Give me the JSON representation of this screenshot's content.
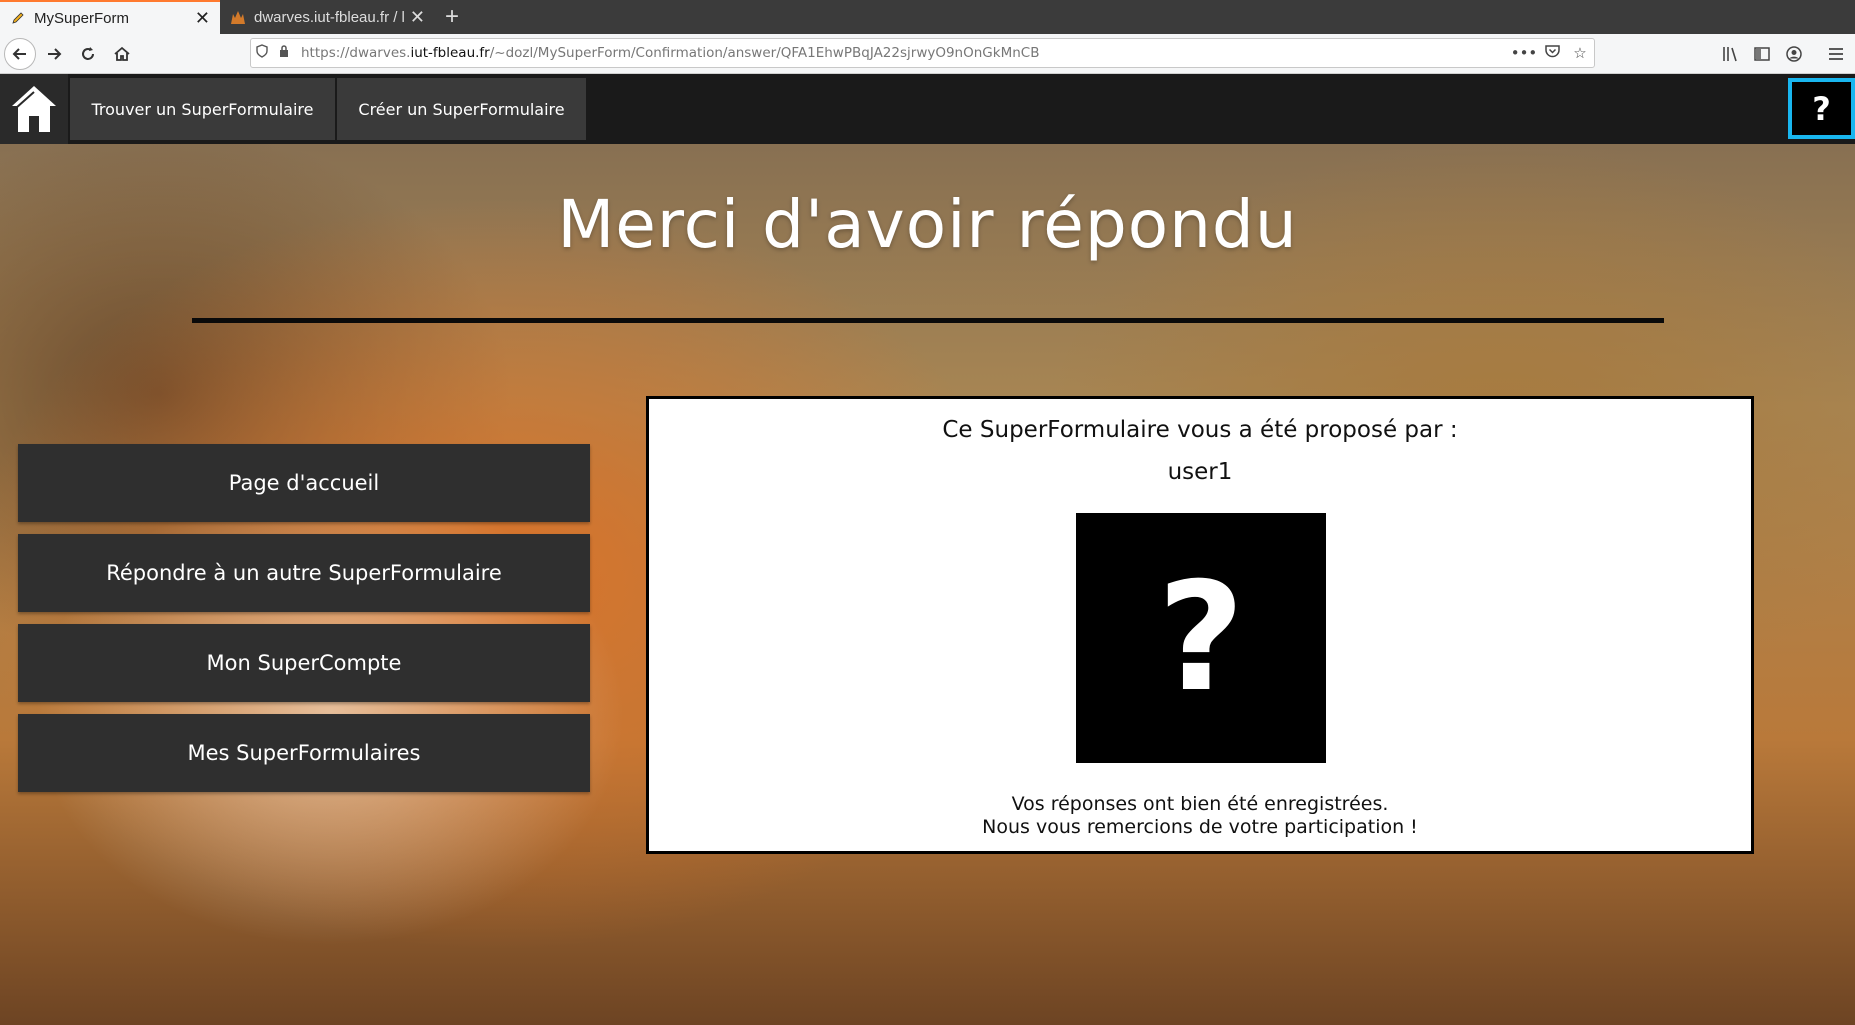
{
  "browser": {
    "tabs": [
      {
        "label": "MySuperForm",
        "active": true
      },
      {
        "label": "dwarves.iut-fbleau.fr / lo",
        "active": false
      }
    ],
    "new_tab": "+",
    "close_glyph": "✕",
    "url_prefix": "https://dwarves.",
    "url_domain": "iut-fbleau.fr",
    "url_path": "/~dozl/MySuperForm/Confirmation/answer/QFA1EhwPBqJA22sjrwyO9nOnGkMnCB",
    "icons": [
      "back-icon",
      "forward-icon",
      "reload-icon",
      "home-icon",
      "shield-icon",
      "lock-icon",
      "more-icon",
      "pocket-icon",
      "bookmark-star-icon",
      "library-icon",
      "sidebar-icon",
      "account-icon",
      "menu-icon"
    ]
  },
  "header": {
    "nav": [
      "Trouver un SuperFormulaire",
      "Créer un SuperFormulaire"
    ],
    "help": "?",
    "help_border_color": "#19b6ef"
  },
  "main": {
    "title": "Merci d'avoir répondu",
    "side_buttons": [
      "Page d'accueil",
      "Répondre à un autre SuperFormulaire",
      "Mon SuperCompte",
      "Mes SuperFormulaires"
    ]
  },
  "card": {
    "title": "Ce SuperFormulaire vous a été proposé par :",
    "user": "user1",
    "avatar_glyph": "?",
    "message_line1": "Vos réponses ont bien été enregistrées.",
    "message_line2": "Nous vous remercions de votre participation !"
  }
}
